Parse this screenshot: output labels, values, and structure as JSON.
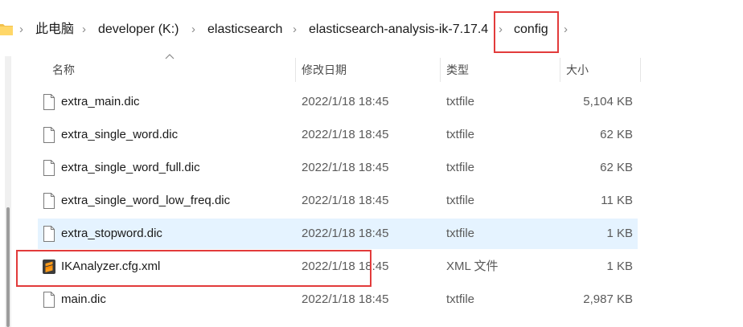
{
  "breadcrumb": {
    "items": [
      "此电脑",
      "developer (K:)",
      "elasticsearch",
      "elasticsearch-analysis-ik-7.17.4",
      "config"
    ]
  },
  "columns": {
    "name": "名称",
    "date": "修改日期",
    "type": "类型",
    "size": "大小"
  },
  "files": [
    {
      "name": "extra_main.dic",
      "date": "2022/1/18 18:45",
      "type": "txtfile",
      "size": "5,104 KB",
      "icon": "document-icon",
      "selected": false
    },
    {
      "name": "extra_single_word.dic",
      "date": "2022/1/18 18:45",
      "type": "txtfile",
      "size": "62 KB",
      "icon": "document-icon",
      "selected": false
    },
    {
      "name": "extra_single_word_full.dic",
      "date": "2022/1/18 18:45",
      "type": "txtfile",
      "size": "62 KB",
      "icon": "document-icon",
      "selected": false
    },
    {
      "name": "extra_single_word_low_freq.dic",
      "date": "2022/1/18 18:45",
      "type": "txtfile",
      "size": "11 KB",
      "icon": "document-icon",
      "selected": false
    },
    {
      "name": "extra_stopword.dic",
      "date": "2022/1/18 18:45",
      "type": "txtfile",
      "size": "1 KB",
      "icon": "document-icon",
      "selected": true
    },
    {
      "name": "IKAnalyzer.cfg.xml",
      "date": "2022/1/18 18:45",
      "type": "XML 文件",
      "size": "1 KB",
      "icon": "sublime-text-icon",
      "selected": false
    },
    {
      "name": "main.dic",
      "date": "2022/1/18 18:45",
      "type": "txtfile",
      "size": "2,987 KB",
      "icon": "document-icon",
      "selected": false
    }
  ],
  "colors": {
    "highlight": "#e23b3b",
    "selected_row": "#e5f3ff"
  }
}
